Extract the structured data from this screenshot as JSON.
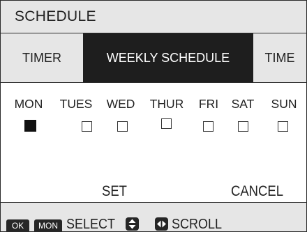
{
  "header": {
    "title": "SCHEDULE"
  },
  "tabs": [
    {
      "label": "TIMER",
      "active": false
    },
    {
      "label": "WEEKLY SCHEDULE",
      "active": true
    },
    {
      "label": "TIME",
      "active": false
    }
  ],
  "days": [
    {
      "label": "MON",
      "checked": true
    },
    {
      "label": "TUES",
      "checked": false
    },
    {
      "label": "WED",
      "checked": false
    },
    {
      "label": "THUR",
      "checked": false
    },
    {
      "label": "FRI",
      "checked": false
    },
    {
      "label": "SAT",
      "checked": false
    },
    {
      "label": "SUN",
      "checked": false
    }
  ],
  "actions": {
    "set": "SET",
    "cancel": "CANCEL"
  },
  "footer": {
    "ok_key": "OK",
    "mon_key": "MON",
    "select_label": "SELECT",
    "scroll_label": "SCROLL",
    "updown_icon": "up-down-arrows-icon",
    "leftright_icon": "left-right-arrows-icon"
  },
  "colors": {
    "bar_bg": "#e6e6e6",
    "selected_bg": "#1e1e1e",
    "selected_fg": "#ffffff"
  }
}
